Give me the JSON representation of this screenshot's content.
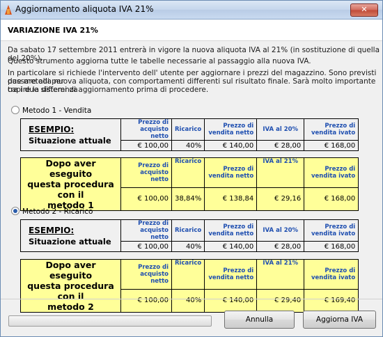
{
  "window": {
    "title": "Aggiornamento aliquota IVA 21%",
    "close_label": "✕"
  },
  "header": {
    "title": "VARIAZIONE IVA 21%"
  },
  "intro": {
    "line1": "Da sabato 17 settembre 2011 entrerà in vigore la nuova aliquota IVA al 21% (in sostituzione di quella del 20%).",
    "line2": "Questo strumento aggiorna tutte le tabelle necessarie al passaggio alla nuova IVA.",
    "line3": "In particolare si richiede l'intervento dell' utente per aggiornare i prezzi del magazzino.  Sono previsti due metodi per",
    "line4": "passare alla nuova aliquota, con comportamenti differenti sul risultato finale. Sarà molto importante capire la differenza",
    "line5": "tra i due sistemi di aggiornamento prima di procedere."
  },
  "headers": {
    "acquisto_1": "Prezzo di",
    "acquisto_2": "acquisto netto",
    "ricarico": "Ricarico",
    "vendita_1": "Prezzo di",
    "vendita_2": "vendita netto",
    "iva20": "IVA al 20%",
    "iva21": "IVA al 21%",
    "ivato_1": "Prezzo di",
    "ivato_2": "vendita ivato"
  },
  "esempio": {
    "title": "ESEMPIO:",
    "subtitle": "Situazione attuale"
  },
  "dopo": {
    "line1": "Dopo aver eseguito",
    "line2": "questa procedura con il",
    "method1": "metodo 1",
    "method2": "metodo 2"
  },
  "method1": {
    "radio_label": "Metodo 1 - Vendita",
    "selected": false,
    "current": [
      "€ 100,00",
      "40%",
      "€ 140,00",
      "€ 28,00",
      "€ 168,00"
    ],
    "after": [
      "€ 100,00",
      "38,84%",
      "€ 138,84",
      "€ 29,16",
      "€ 168,00"
    ]
  },
  "method2": {
    "radio_label": "Metodo 2 - Ricarico",
    "selected": true,
    "current": [
      "€ 100,00",
      "40%",
      "€ 140,00",
      "€ 28,00",
      "€ 168,00"
    ],
    "after": [
      "€ 100,00",
      "40%",
      "€ 140,00",
      "€ 29,40",
      "€ 169,40"
    ]
  },
  "footer": {
    "progress": 0,
    "cancel_label": "Annulla",
    "update_label": "Aggiorna IVA"
  }
}
